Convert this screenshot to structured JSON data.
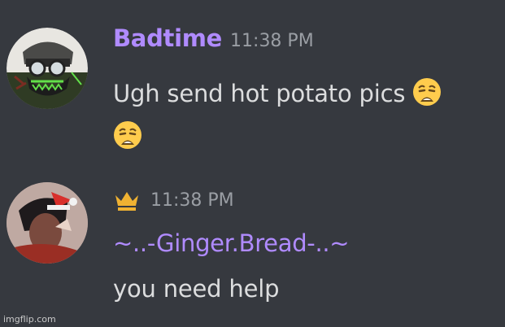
{
  "messages": [
    {
      "username": "Badtime",
      "timestamp": "11:38 PM",
      "text_line1": "Ugh send hot potato pics",
      "text_line2": "",
      "emoji": "weary-face-icon",
      "colors": {
        "username": "#b08bff"
      }
    },
    {
      "username": "~..-Ginger.Bread-..~",
      "timestamp": "11:38 PM",
      "text": "you need help",
      "badge": "crown-icon",
      "colors": {
        "username": "#b08bff",
        "badge": "#f0b232"
      }
    }
  ],
  "watermark": "imgflip.com",
  "theme": {
    "background": "#36393f",
    "text": "#dcddde",
    "timestamp": "#9a9ea4"
  }
}
